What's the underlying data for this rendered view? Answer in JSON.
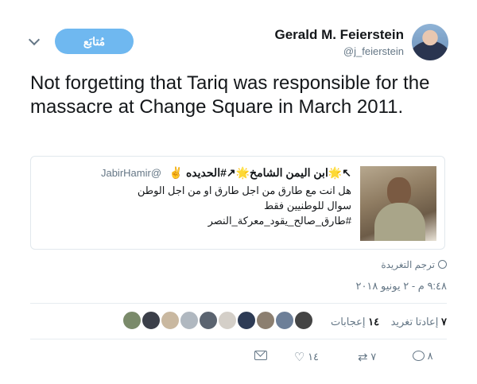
{
  "header": {
    "display_name": "Gerald M. Feierstein",
    "handle": "@j_feierstein",
    "follow_label": "مُتابَع"
  },
  "tweet": {
    "text": "Not forgetting that Tariq was responsible for the massacre at Change Square in March 2011."
  },
  "quote": {
    "name": "↖🌟ابن اليمن الشامخ🌟↗#الحديده ✌",
    "handle": "@JabirHamir",
    "line1": "هل انت مع طارق من اجل طارق او من اجل الوطن سوال للوطنيين فقط",
    "line2": "#طارق_صالح_يقود_معركة_النصر"
  },
  "translate_label": "ترجم التغريدة",
  "timestamp": "٩:٤٨ م - ٢ يونيو ٢٠١٨",
  "stats": {
    "retweets_count": "٧",
    "retweets_label": "إعادتا تغريد",
    "likes_count": "١٤",
    "likes_label": "إعجابات"
  },
  "likers_colors": [
    "#7a8a6a",
    "#3b3f49",
    "#c9b8a0",
    "#b0b8c0",
    "#5b6470",
    "#d4cfc8",
    "#2d3b55",
    "#8c7f70",
    "#6d7f98",
    "#444444"
  ],
  "actions": {
    "reply_count": "٨",
    "retweet_count": "٧",
    "like_count": "١٤"
  },
  "icons": {
    "caret": "chevron-down-icon",
    "globe": "globe-icon",
    "reply": "reply-icon",
    "retweet": "retweet-icon",
    "like": "heart-icon",
    "dm": "direct-message-icon"
  }
}
